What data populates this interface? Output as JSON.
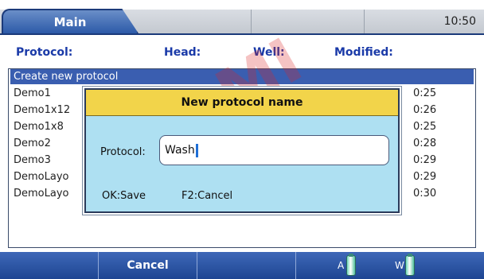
{
  "tabs": [
    {
      "label": "Main",
      "active": true
    },
    {
      "label": "",
      "active": false
    },
    {
      "label": "",
      "active": false
    },
    {
      "label": "",
      "active": false
    }
  ],
  "clock": "10:50",
  "header": {
    "protocol": "Protocol:",
    "head": "Head:",
    "well": "Well:",
    "modified": "Modified:"
  },
  "list": {
    "rows": [
      {
        "name": "Create new protocol",
        "time": "",
        "selected": true
      },
      {
        "name": "Demo1",
        "time": "0:25"
      },
      {
        "name": "Demo1x12",
        "time": "0:26"
      },
      {
        "name": "Demo1x8",
        "time": "0:25"
      },
      {
        "name": "Demo2",
        "time": "0:28"
      },
      {
        "name": "Demo3",
        "time": "0:29"
      },
      {
        "name": "DemoLayo",
        "time": "0:29"
      },
      {
        "name": "DemoLayo",
        "time": "0:30"
      }
    ]
  },
  "dialog": {
    "title": "New protocol name",
    "field_label": "Protocol:",
    "field_value": "Wash",
    "ok_hint": "OK:Save",
    "cancel_hint": "F2:Cancel"
  },
  "softkeys": [
    "",
    "Cancel",
    "",
    ""
  ],
  "bottles": [
    {
      "label": "A"
    },
    {
      "label": "W"
    }
  ],
  "watermark": "DOMI",
  "colors": {
    "accent_blue": "#2c5aa8",
    "dialog_title": "#f2d44a",
    "dialog_body": "#aee0f2",
    "header_text": "#1a3aa8"
  }
}
